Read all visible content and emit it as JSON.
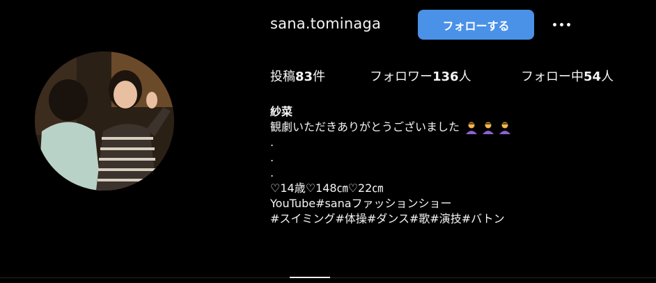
{
  "profile": {
    "username": "sana.tominaga",
    "follow_label": "フォローする",
    "more_icon": "more-horizontal-icon",
    "accent": "#4a91e8"
  },
  "stats": {
    "posts_prefix": "投稿",
    "posts_count": "83",
    "posts_suffix": "件",
    "followers_prefix": "フォロワー",
    "followers_count": "136",
    "followers_suffix": "人",
    "following_prefix": "フォロー中",
    "following_count": "54",
    "following_suffix": "人"
  },
  "bio": {
    "name": "紗菜",
    "line1": "観劇いただきありがとうございました",
    "emoji_icon": "person-bowing-icon",
    "dot1": ".",
    "dot2": ".",
    "dot3": ".",
    "line_stats": "♡14歳♡148㎝♡22㎝",
    "line_youtube": "YouTube#sanaファッションショー",
    "line_tags": "#スイミング#体操#ダンス#歌#演技#バトン"
  }
}
